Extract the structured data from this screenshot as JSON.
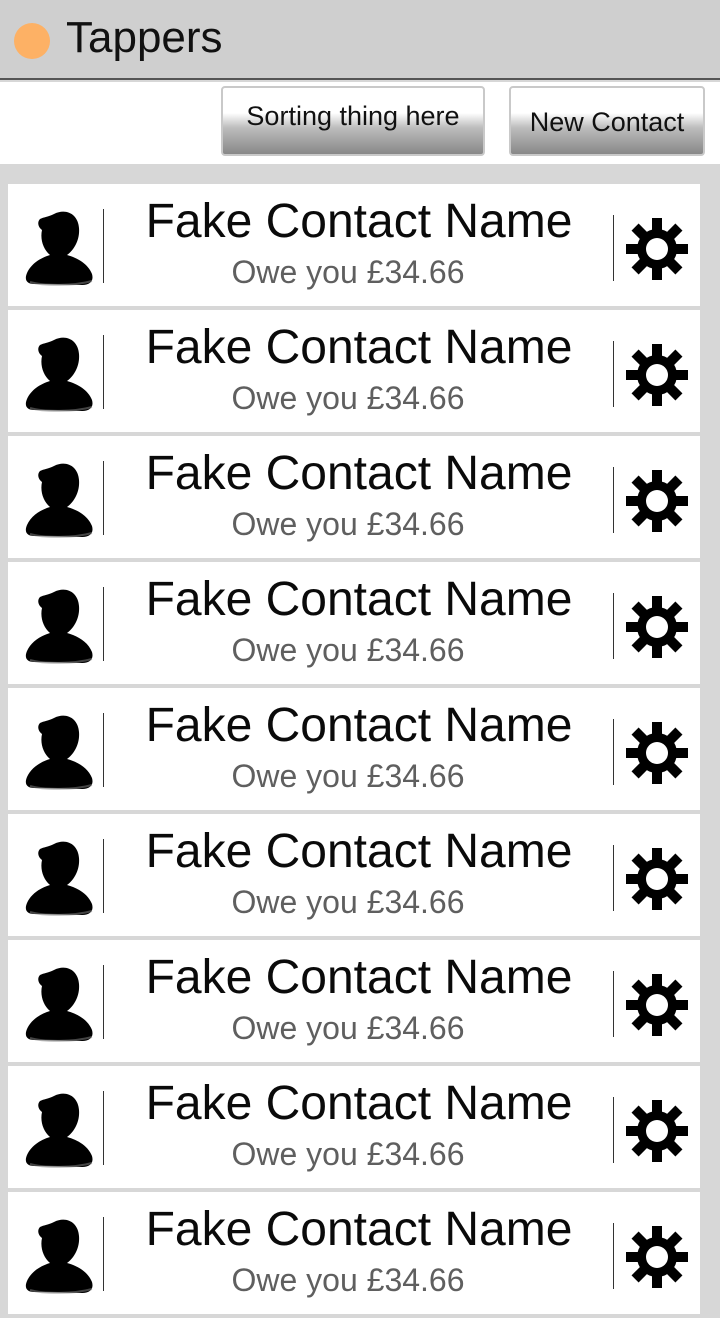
{
  "app": {
    "title": "Tappers",
    "accent_color": "#fdb165"
  },
  "toolbar": {
    "sort_label": "Sorting thing here",
    "new_contact_label": "New Contact"
  },
  "contacts": [
    {
      "name": "Fake Contact Name",
      "owe": "Owe you £34.66"
    },
    {
      "name": "Fake Contact Name",
      "owe": "Owe you £34.66"
    },
    {
      "name": "Fake Contact Name",
      "owe": "Owe you £34.66"
    },
    {
      "name": "Fake Contact Name",
      "owe": "Owe you £34.66"
    },
    {
      "name": "Fake Contact Name",
      "owe": "Owe you £34.66"
    },
    {
      "name": "Fake Contact Name",
      "owe": "Owe you £34.66"
    },
    {
      "name": "Fake Contact Name",
      "owe": "Owe you £34.66"
    },
    {
      "name": "Fake Contact Name",
      "owe": "Owe you £34.66"
    },
    {
      "name": "Fake Contact Name",
      "owe": "Owe you £34.66"
    }
  ],
  "icons": {
    "app": "circle-icon",
    "avatar": "person-icon",
    "settings": "gear-icon"
  }
}
